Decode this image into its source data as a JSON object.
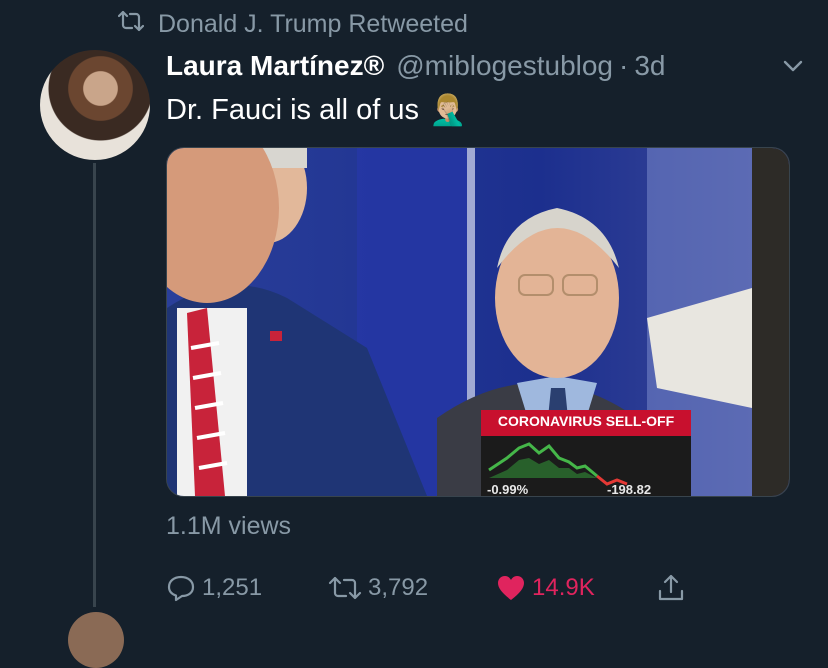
{
  "retweet_context": {
    "text": "Donald J. Trump Retweeted"
  },
  "tweet": {
    "display_name": "Laura Martínez®",
    "handle": "@miblogestublog",
    "separator": "·",
    "time": "3d",
    "text": "Dr. Fauci is all of us",
    "emoji": "🤦🏼‍♂️",
    "views": "1.1M views"
  },
  "media": {
    "chyron_title": "CORONAVIRUS SELL-OFF",
    "ticker_left": "-0.99%",
    "ticker_right": "-198.82"
  },
  "actions": {
    "replies": "1,251",
    "retweets": "3,792",
    "likes": "14.9K"
  },
  "colors": {
    "background": "#15202b",
    "secondary_text": "#8899a6",
    "like": "#e0245e",
    "chyron_red": "#c8102e"
  }
}
